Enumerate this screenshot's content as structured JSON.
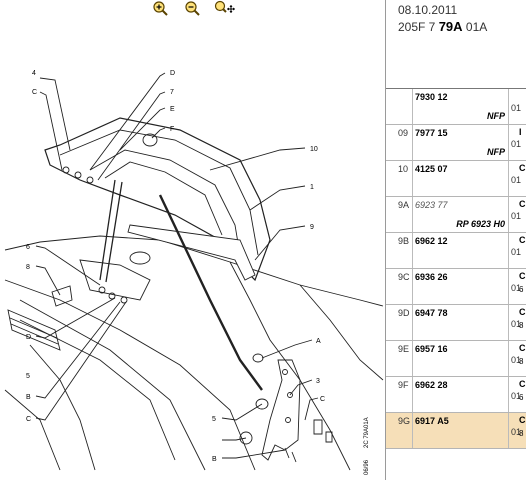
{
  "toolbar": {
    "zoom_in_icon": "zoom-in",
    "zoom_out_icon": "zoom-out",
    "zoom_pan_icon": "zoom-pan"
  },
  "header": {
    "date": "08.10.2011",
    "code_prefix": "205F 7 ",
    "code_bold": "79A",
    "code_suffix": " 01A"
  },
  "diagram": {
    "callouts": [
      "4",
      "C",
      "D",
      "7",
      "E",
      "F",
      "10",
      "1",
      "9",
      "6",
      "8",
      "D",
      "5",
      "B",
      "C",
      "A",
      "3",
      "5",
      "B",
      "C"
    ],
    "stamp_left": "06/96",
    "stamp_right": "2C 79A01A"
  },
  "parts": [
    {
      "item": "",
      "ref": "7930 12",
      "note": "NFP",
      "qty": "01",
      "extra_top": "",
      "extra_bottom": ""
    },
    {
      "item": "09",
      "ref": "7977 15",
      "note": "NFP",
      "qty": "01",
      "extra_top": "I",
      "extra_bottom": ""
    },
    {
      "item": "10",
      "ref": "4125 07",
      "note": "",
      "qty": "01",
      "extra_top": "C",
      "extra_bottom": ""
    },
    {
      "item": "9A",
      "ref": "6923 77",
      "note": "RP 6923 H0",
      "qty": "01",
      "extra_top": "C",
      "extra_bottom": ""
    },
    {
      "item": "9B",
      "ref": "6962 12",
      "note": "",
      "qty": "01",
      "extra_top": "C",
      "extra_bottom": ""
    },
    {
      "item": "9C",
      "ref": "6936 26",
      "note": "",
      "qty": "01",
      "extra_top": "C",
      "extra_bottom": "6"
    },
    {
      "item": "9D",
      "ref": "6947 78",
      "note": "",
      "qty": "01",
      "extra_top": "C",
      "extra_bottom": "8"
    },
    {
      "item": "9E",
      "ref": "6957 16",
      "note": "",
      "qty": "01",
      "extra_top": "C",
      "extra_bottom": "8"
    },
    {
      "item": "9F",
      "ref": "6962 28",
      "note": "",
      "qty": "01",
      "extra_top": "C",
      "extra_bottom": "6"
    },
    {
      "item": "9G",
      "ref": "6917 A5",
      "note": "",
      "qty": "01",
      "extra_top": "C",
      "extra_bottom": "8"
    }
  ]
}
